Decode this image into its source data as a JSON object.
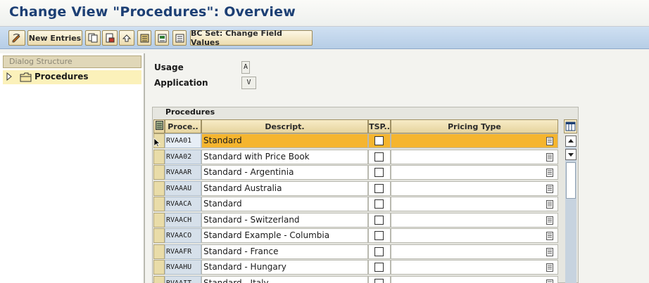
{
  "window": {
    "title": "Change View \"Procedures\": Overview"
  },
  "toolbar": {
    "new_entries_label": "New Entries",
    "bc_set_label": "BC Set: Change Field Values",
    "icons": [
      "display-change-icon",
      "copy-icon",
      "delete-icon",
      "undo-icon",
      "select-all-icon",
      "select-block-icon",
      "deselect-all-icon"
    ]
  },
  "dialog_structure": {
    "header": "Dialog Structure",
    "items": [
      {
        "label": "Procedures",
        "icon": "folder-open-icon",
        "selected": true
      }
    ]
  },
  "fields": {
    "usage_label": "Usage",
    "usage_value": "A",
    "application_label": "Application",
    "application_value": "V"
  },
  "table": {
    "title": "Procedures",
    "columns": [
      "Proce..",
      "Descript.",
      "TSP..",
      "Pricing Type"
    ],
    "rows": [
      {
        "proc": "RVAA01",
        "desc": "Standard",
        "tsp": false,
        "pricing_type": "",
        "selected": true
      },
      {
        "proc": "RVAA02",
        "desc": "Standard with Price Book",
        "tsp": false,
        "pricing_type": ""
      },
      {
        "proc": "RVAAAR",
        "desc": "Standard - Argentinia",
        "tsp": false,
        "pricing_type": ""
      },
      {
        "proc": "RVAAAU",
        "desc": "Standard Australia",
        "tsp": false,
        "pricing_type": ""
      },
      {
        "proc": "RVAACA",
        "desc": "Standard",
        "tsp": false,
        "pricing_type": ""
      },
      {
        "proc": "RVAACH",
        "desc": "Standard - Switzerland",
        "tsp": false,
        "pricing_type": ""
      },
      {
        "proc": "RVAACO",
        "desc": "Standard Example - Columbia",
        "tsp": false,
        "pricing_type": ""
      },
      {
        "proc": "RVAAFR",
        "desc": "Standard - France",
        "tsp": false,
        "pricing_type": ""
      },
      {
        "proc": "RVAAHU",
        "desc": "Standard - Hungary",
        "tsp": false,
        "pricing_type": ""
      },
      {
        "proc": "RVAAIT",
        "desc": "Standard - Italy",
        "tsp": false,
        "pricing_type": ""
      }
    ]
  },
  "colors": {
    "title": "#1c3f74",
    "toolbar": "#b6cde6",
    "selected_row": "#f5b52f",
    "tree_selected": "#fbf1ba"
  }
}
